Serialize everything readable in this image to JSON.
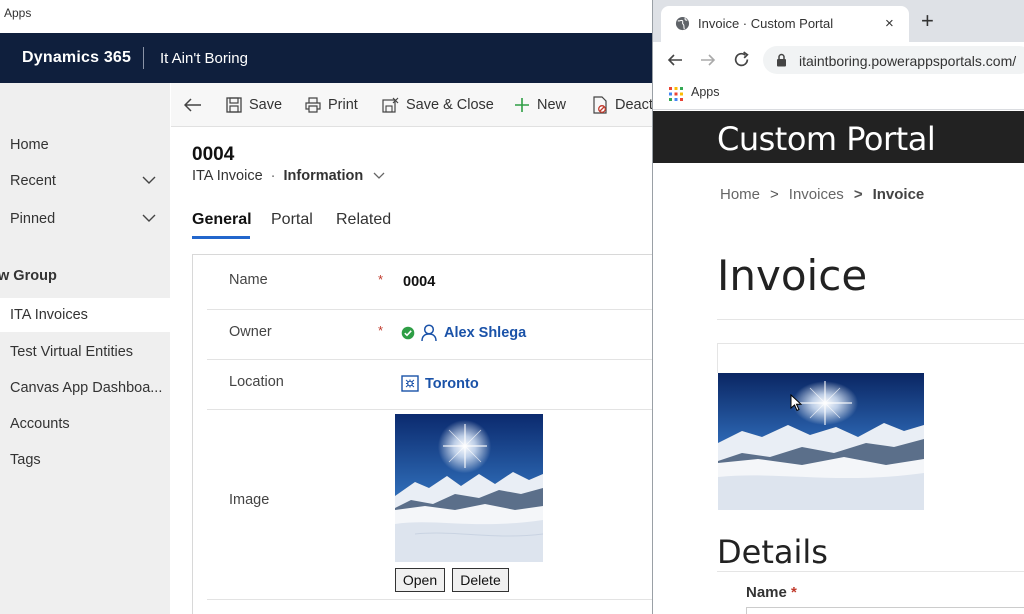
{
  "dynamics": {
    "titlebar": "Apps",
    "header": {
      "brand": "Dynamics 365",
      "app_name": "It Ain't Boring"
    },
    "sidebar": {
      "items": [
        {
          "label": "Home"
        },
        {
          "label": "Recent"
        },
        {
          "label": "Pinned"
        }
      ],
      "group_label": "w Group",
      "group_items": [
        {
          "label": "ITA Invoices",
          "active": true
        },
        {
          "label": "Test Virtual Entities"
        },
        {
          "label": "Canvas App Dashboa..."
        },
        {
          "label": "Accounts"
        },
        {
          "label": "Tags"
        }
      ]
    },
    "commandbar": {
      "save": "Save",
      "print": "Print",
      "save_close": "Save & Close",
      "new": "New",
      "deactivate": "Deact"
    },
    "record": {
      "title": "0004",
      "entity": "ITA Invoice",
      "separator": "·",
      "form": "Information"
    },
    "tabs": [
      {
        "label": "General",
        "active": true
      },
      {
        "label": "Portal"
      },
      {
        "label": "Related"
      }
    ],
    "fields": {
      "name": {
        "label": "Name",
        "required_mark": "*",
        "value": "0004"
      },
      "owner": {
        "label": "Owner",
        "required_mark": "*",
        "value": "Alex Shlega"
      },
      "location": {
        "label": "Location",
        "value": "Toronto"
      },
      "image": {
        "label": "Image",
        "open": "Open",
        "delete": "Delete"
      }
    }
  },
  "chrome": {
    "tab_title": "Invoice · Custom Portal",
    "tab_close": "×",
    "new_tab": "+",
    "url": "itaintboring.powerappsportals.com/",
    "bookmark": "Apps"
  },
  "portal": {
    "site_title": "Custom Portal",
    "breadcrumb": {
      "home": "Home",
      "sep": ">",
      "invoices": "Invoices",
      "current": "Invoice"
    },
    "heading": "Invoice",
    "details_heading": "Details",
    "name_label": "Name",
    "name_required": "*"
  },
  "colors": {
    "dynamics_header": "#0f1f3d",
    "sidebar_bg": "#efefef",
    "link": "#1a52a8",
    "tab_accent": "#2266cc",
    "portal_header": "#222222",
    "required": "#c0392b",
    "owner_status": "#2e9e45"
  }
}
